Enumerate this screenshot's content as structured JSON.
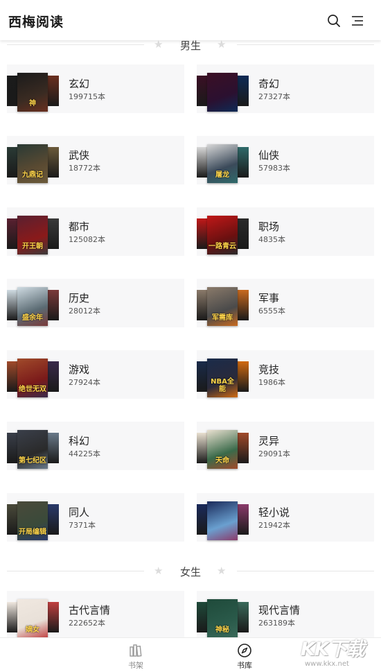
{
  "header": {
    "title": "西梅阅读",
    "search_icon": "search-icon",
    "menu_icon": "menu-icon"
  },
  "sections": {
    "male": {
      "label": "男生"
    },
    "female": {
      "label": "女生"
    }
  },
  "categories": [
    {
      "name": "玄幻",
      "count": "199715本",
      "cover_title": "神",
      "colors": [
        "#3a2b22",
        "#1b1b1b",
        "#6a2f1f"
      ]
    },
    {
      "name": "奇幻",
      "count": "27327本",
      "cover_title": "",
      "colors": [
        "#2b1030",
        "#3b0f25",
        "#0e2a55"
      ]
    },
    {
      "name": "武侠",
      "count": "18772本",
      "cover_title": "九鼎记",
      "colors": [
        "#5a4a32",
        "#2a3a35",
        "#6b5a3a"
      ]
    },
    {
      "name": "仙侠",
      "count": "57983本",
      "cover_title": "屠龙",
      "colors": [
        "#3b4a5a",
        "#d8d8d8",
        "#2f6a6a"
      ]
    },
    {
      "name": "都市",
      "count": "125082本",
      "cover_title": "开王朝",
      "colors": [
        "#8a1a1a",
        "#5a2030",
        "#3a3a3a"
      ]
    },
    {
      "name": "职场",
      "count": "4835本",
      "cover_title": "一路青云",
      "colors": [
        "#6a1010",
        "#c01818",
        "#2a2a2a"
      ]
    },
    {
      "name": "历史",
      "count": "28012本",
      "cover_title": "盛余年",
      "colors": [
        "#5a6a72",
        "#cfdbe2",
        "#7a3a3a"
      ]
    },
    {
      "name": "军事",
      "count": "6555本",
      "cover_title": "军需库",
      "colors": [
        "#4a4a4a",
        "#8a7a6a",
        "#c96a1f"
      ]
    },
    {
      "name": "游戏",
      "count": "27924本",
      "cover_title": "绝世无双",
      "colors": [
        "#7a1a1a",
        "#a04a2a",
        "#3a2a4a"
      ]
    },
    {
      "name": "竞技",
      "count": "1986本",
      "cover_title": "NBA全能",
      "colors": [
        "#2a2a3a",
        "#1a2b4a",
        "#d06a10"
      ]
    },
    {
      "name": "科幻",
      "count": "44225本",
      "cover_title": "第七纪区",
      "colors": [
        "#2a2a2a",
        "#3a3f4a",
        "#6a7a8a"
      ]
    },
    {
      "name": "灵异",
      "count": "29091本",
      "cover_title": "天命",
      "colors": [
        "#3a6a4a",
        "#e9e0d0",
        "#a04a2a"
      ]
    },
    {
      "name": "同人",
      "count": "7371本",
      "cover_title": "开局编辑",
      "colors": [
        "#3a4a3a",
        "#4a4a3a",
        "#2a3a6a"
      ]
    },
    {
      "name": "轻小说",
      "count": "21942本",
      "cover_title": "",
      "colors": [
        "#6aa0d0",
        "#1a2a5a",
        "#8a3a6a"
      ]
    },
    {
      "name": "古代言情",
      "count": "222652本",
      "cover_title": "嫡女",
      "colors": [
        "#e8e0d8",
        "#f0e8e0",
        "#c04040"
      ]
    },
    {
      "name": "现代言情",
      "count": "263189本",
      "cover_title": "神秘",
      "colors": [
        "#2a5a4a",
        "#1f4a3a",
        "#3a6a5a"
      ]
    }
  ],
  "tabs": [
    {
      "label": "书架",
      "icon": "bookshelf-icon",
      "active": false
    },
    {
      "label": "书库",
      "icon": "compass-icon",
      "active": true
    }
  ],
  "watermark": {
    "text": "KK下载",
    "url": "www.kkx.net"
  }
}
